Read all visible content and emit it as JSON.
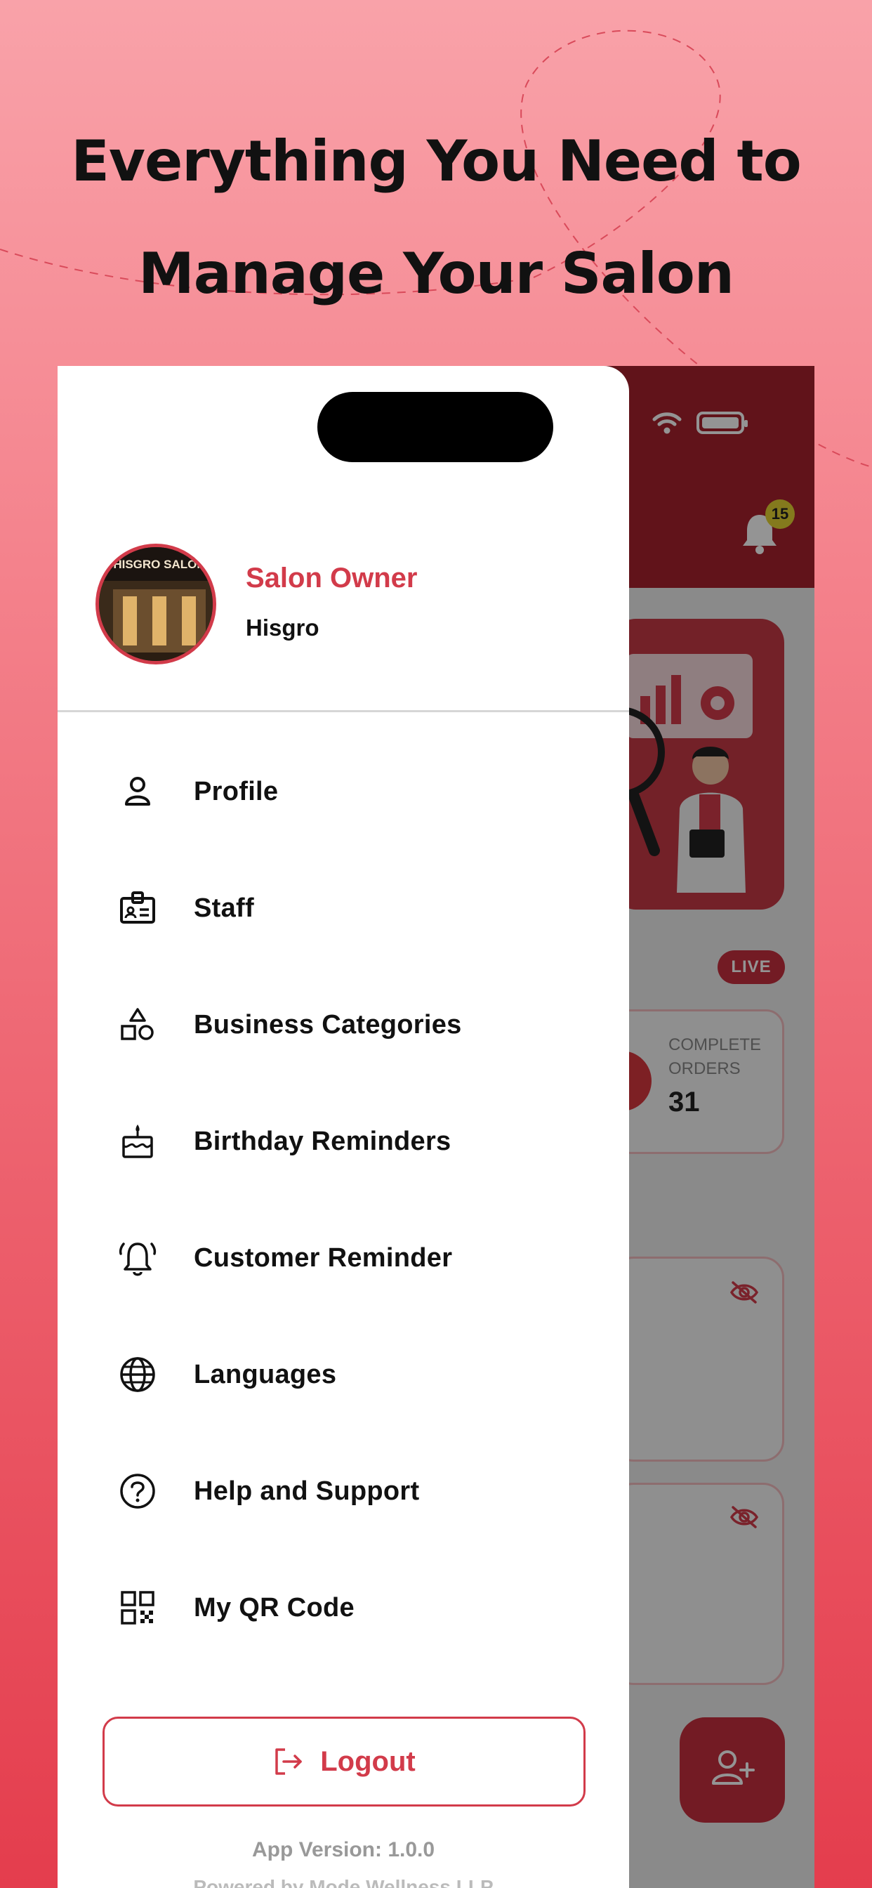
{
  "headline": {
    "line1": "Everything You Need to",
    "line2": "Manage Your Salon"
  },
  "background_app": {
    "notification_count": "15",
    "live_label": "LIVE",
    "complete_orders_label": "COMPLETE ORDERS",
    "complete_orders_value": "31",
    "fab_icon": "add-user-icon"
  },
  "drawer": {
    "user": {
      "role": "Salon Owner",
      "business": "Hisgro",
      "avatar_text": "HISGRO SALON"
    },
    "menu": [
      {
        "label": "Profile",
        "icon": "person-icon"
      },
      {
        "label": "Staff",
        "icon": "id-badge-icon"
      },
      {
        "label": "Business Categories",
        "icon": "shapes-icon"
      },
      {
        "label": "Birthday Reminders",
        "icon": "cake-icon"
      },
      {
        "label": "Customer Reminder",
        "icon": "alarm-bell-icon"
      },
      {
        "label": "Languages",
        "icon": "globe-icon"
      },
      {
        "label": "Help and Support",
        "icon": "help-circle-icon"
      },
      {
        "label": "My QR Code",
        "icon": "qr-code-icon"
      }
    ],
    "logout_label": "Logout",
    "app_version": "App Version: 1.0.0",
    "powered_by": "Powered by Mode Wellness LLP"
  },
  "colors": {
    "accent": "#d23b4a",
    "header_dark": "#a8212d",
    "background_top": "#f9a2a9",
    "background_bottom": "#e43d4d"
  }
}
